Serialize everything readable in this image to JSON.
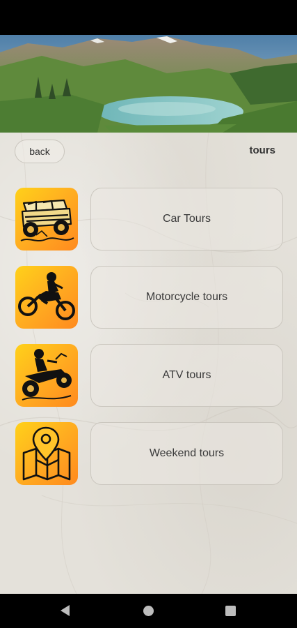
{
  "header": {
    "back_label": "back",
    "title": "tours"
  },
  "tours": [
    {
      "label": "Car Tours",
      "icon": "jeep-icon"
    },
    {
      "label": "Motorcycle tours",
      "icon": "motorcycle-icon"
    },
    {
      "label": "ATV tours",
      "icon": "atv-icon"
    },
    {
      "label": "Weekend tours",
      "icon": "map-pin-icon"
    }
  ],
  "colors": {
    "icon_gradient_start": "#ffd11a",
    "icon_gradient_end": "#ff8a1f",
    "background": "#e4e1da",
    "text": "#3a3a3a"
  },
  "hero": {
    "image": "mountain-lake-photo"
  },
  "navigation": {
    "back_icon": "nav-back-triangle-icon",
    "home_icon": "nav-home-circle-icon",
    "recents_icon": "nav-recents-square-icon"
  }
}
